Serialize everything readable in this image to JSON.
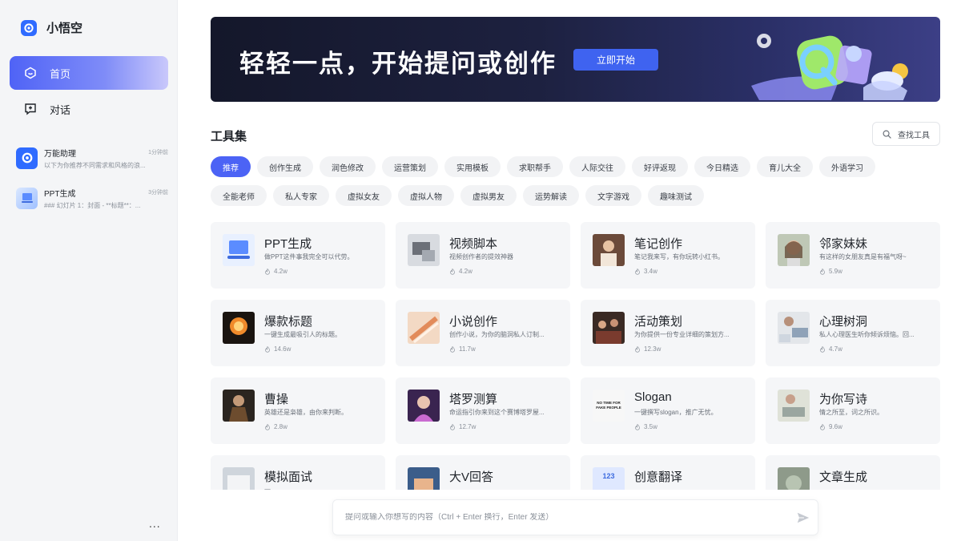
{
  "app": {
    "name": "小悟空"
  },
  "nav": {
    "home": "首页",
    "chat": "对话"
  },
  "history": [
    {
      "title": "万能助理",
      "time": "1分钟前",
      "preview": "以下为你推荐不同需求和风格的浪..."
    },
    {
      "title": "PPT生成",
      "time": "3分钟前",
      "preview": "### 幻灯片 1：封面 - **标题**：..."
    }
  ],
  "sidebar_more": "...",
  "banner": {
    "title": "轻轻一点，开始提问或创作",
    "button": "立即开始"
  },
  "tools": {
    "title": "工具集",
    "search_label": "查找工具"
  },
  "chips": [
    "推荐",
    "创作生成",
    "润色修改",
    "运营策划",
    "实用模板",
    "求职帮手",
    "人际交往",
    "好评返现",
    "今日精选",
    "育儿大全",
    "外语学习",
    "全能老师",
    "私人专家",
    "虚拟女友",
    "虚拟人物",
    "虚拟男友",
    "运势解读",
    "文字游戏",
    "趣味测试"
  ],
  "active_chip": "推荐",
  "cards": [
    {
      "title": "PPT生成",
      "desc": "做PPT这件事我完全可以代劳。",
      "count": "4.2w",
      "thumb": "ppt"
    },
    {
      "title": "视频脚本",
      "desc": "视频创作者的提效神器",
      "count": "4.2w",
      "thumb": "video"
    },
    {
      "title": "笔记创作",
      "desc": "笔记我来写，有你玩转小红书。",
      "count": "3.4w",
      "thumb": "note"
    },
    {
      "title": "邻家妹妹",
      "desc": "有这样的女朋友真是有福气呀~",
      "count": "5.9w",
      "thumb": "girl"
    },
    {
      "title": "爆款标题",
      "desc": "一键生成最吸引人的标题。",
      "count": "14.6w",
      "thumb": "fire"
    },
    {
      "title": "小说创作",
      "desc": "创作小说，为你的脑洞私人订制...",
      "count": "11.7w",
      "thumb": "novel"
    },
    {
      "title": "活动策划",
      "desc": "为你提供一份专业详细的策划方...",
      "count": "12.3w",
      "thumb": "party"
    },
    {
      "title": "心理树洞",
      "desc": "私人心理医生听你倾诉烦恼。回...",
      "count": "4.7w",
      "thumb": "psy"
    },
    {
      "title": "曹操",
      "desc": "英雄还是枭雄，由你来判断。",
      "count": "2.8w",
      "thumb": "caocao"
    },
    {
      "title": "塔罗测算",
      "desc": "命运指引你来到这个赛博塔罗屋...",
      "count": "12.7w",
      "thumb": "tarot"
    },
    {
      "title": "Slogan",
      "desc": "一键撰写slogan，推广无忧。",
      "count": "3.5w",
      "thumb": "slogan",
      "thumb_text": "NO TIME FOR FAKE PEOPLE"
    },
    {
      "title": "为你写诗",
      "desc": "情之所至，词之所识。",
      "count": "9.6w",
      "thumb": "poem"
    },
    {
      "title": "模拟面试",
      "desc": "一",
      "count": "",
      "thumb": "interview"
    },
    {
      "title": "大V回答",
      "desc": "",
      "count": "",
      "thumb": "bigv"
    },
    {
      "title": "创意翻译",
      "desc": "",
      "count": "",
      "thumb": "translate",
      "thumb_text": "123"
    },
    {
      "title": "文章生成",
      "desc": "",
      "count": "",
      "thumb": "article"
    }
  ],
  "chat_input": {
    "placeholder": "提问或输入你想写的内容（Ctrl + Enter 换行，Enter 发送）"
  },
  "colors": {
    "accent": "#4c63f5",
    "brand": "#2f6bff"
  }
}
